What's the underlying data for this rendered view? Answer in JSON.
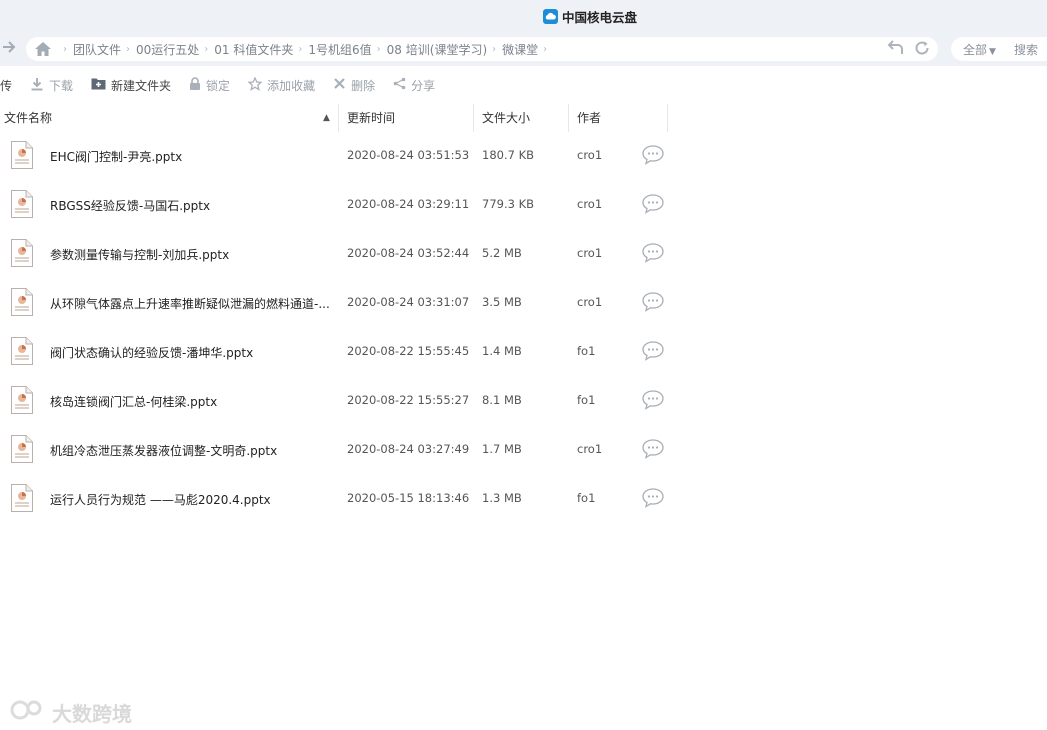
{
  "app": {
    "title": "中国核电云盘"
  },
  "breadcrumb": {
    "items": [
      "团队文件",
      "00运行五处",
      "01 科值文件夹",
      "1号机组6值",
      "08 培训(课堂学习)",
      "微课堂"
    ]
  },
  "search": {
    "scope_label": "全部",
    "button_label": "搜索"
  },
  "toolbar": {
    "upload_label": "传",
    "download_label": "下载",
    "new_folder_label": "新建文件夹",
    "lock_label": "锁定",
    "favorite_label": "添加收藏",
    "delete_label": "删除",
    "share_label": "分享"
  },
  "table": {
    "headers": {
      "name": "文件名称",
      "time": "更新时间",
      "size": "文件大小",
      "author": "作者"
    },
    "rows": [
      {
        "name": "EHC阀门控制-尹亮.pptx",
        "time": "2020-08-24 03:51:53",
        "size": "180.7 KB",
        "author": "cro1"
      },
      {
        "name": "RBGSS经验反馈-马国石.pptx",
        "time": "2020-08-24 03:29:11",
        "size": "779.3 KB",
        "author": "cro1"
      },
      {
        "name": "参数测量传输与控制-刘加兵.pptx",
        "time": "2020-08-24 03:52:44",
        "size": "5.2 MB",
        "author": "cro1"
      },
      {
        "name": "从环隙气体露点上升速率推断疑似泄漏的燃料通道-...",
        "time": "2020-08-24 03:31:07",
        "size": "3.5 MB",
        "author": "cro1"
      },
      {
        "name": "阀门状态确认的经验反馈-潘坤华.pptx",
        "time": "2020-08-22 15:55:45",
        "size": "1.4 MB",
        "author": "fo1"
      },
      {
        "name": "核岛连锁阀门汇总-何桂梁.pptx",
        "time": "2020-08-22 15:55:27",
        "size": "8.1 MB",
        "author": "fo1"
      },
      {
        "name": "机组冷态泄压蒸发器液位调整-文明奇.pptx",
        "time": "2020-08-24 03:27:49",
        "size": "1.7 MB",
        "author": "cro1"
      },
      {
        "name": "运行人员行为规范 ——马彪2020.4.pptx",
        "time": "2020-05-15 18:13:46",
        "size": "1.3 MB",
        "author": "fo1"
      }
    ]
  },
  "watermark": {
    "text": "大数跨境"
  },
  "colors": {
    "accent": "#1d8ed6",
    "chrome": "#eef1f5",
    "muted": "#9aa1a9"
  }
}
